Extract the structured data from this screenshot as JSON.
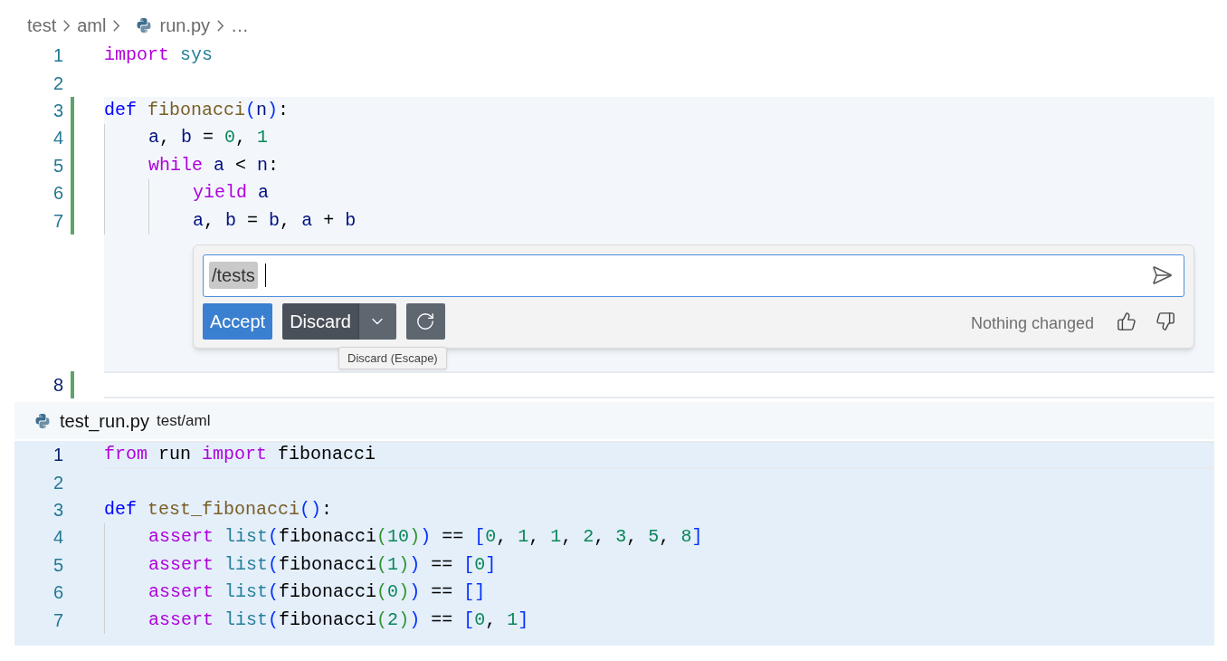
{
  "breadcrumb": [
    {
      "label": "test",
      "kind": "folder"
    },
    {
      "label": "aml",
      "kind": "folder"
    },
    {
      "label": "run.py",
      "kind": "python-file"
    },
    {
      "label": "…",
      "kind": "more"
    }
  ],
  "editor": {
    "lines": [
      {
        "number": "1",
        "changed": false,
        "current": false,
        "tokens": [
          {
            "kind": "keyword",
            "text": "import"
          },
          {
            "kind": "module",
            "text": " sys"
          }
        ]
      },
      {
        "number": "2",
        "changed": false,
        "current": false
      },
      {
        "number": "3",
        "changed": true,
        "current": false,
        "tokens": [
          {
            "kind": "storage",
            "text": "def"
          },
          {
            "kind": "function",
            "text": " fibonacci"
          },
          {
            "kind": "bracket",
            "text": "("
          },
          {
            "kind": "variable",
            "text": "n"
          },
          {
            "kind": "bracket",
            "text": ")"
          },
          {
            "kind": "plain",
            "text": ":"
          }
        ]
      },
      {
        "number": "4",
        "changed": true,
        "current": false,
        "tokens": [
          {
            "kind": "variable",
            "text": "    a"
          },
          {
            "kind": "plain",
            "text": ", "
          },
          {
            "kind": "variable",
            "text": "b"
          },
          {
            "kind": "plain",
            "text": " = "
          },
          {
            "kind": "number",
            "text": "0"
          },
          {
            "kind": "plain",
            "text": ", "
          },
          {
            "kind": "number",
            "text": "1"
          }
        ]
      },
      {
        "number": "5",
        "changed": true,
        "current": false,
        "tokens": [
          {
            "kind": "keyword",
            "text": "    while"
          },
          {
            "kind": "variable",
            "text": " a"
          },
          {
            "kind": "plain",
            "text": " < "
          },
          {
            "kind": "variable",
            "text": "n"
          },
          {
            "kind": "plain",
            "text": ":"
          }
        ]
      },
      {
        "number": "6",
        "changed": true,
        "current": false,
        "tokens": [
          {
            "kind": "keyword",
            "text": "        yield"
          },
          {
            "kind": "variable",
            "text": " a"
          }
        ]
      },
      {
        "number": "7",
        "changed": true,
        "current": false,
        "tokens": [
          {
            "kind": "variable",
            "text": "        a"
          },
          {
            "kind": "plain",
            "text": ", "
          },
          {
            "kind": "variable",
            "text": "b"
          },
          {
            "kind": "plain",
            "text": " = "
          },
          {
            "kind": "variable",
            "text": "b"
          },
          {
            "kind": "plain",
            "text": ", "
          },
          {
            "kind": "variable",
            "text": "a"
          },
          {
            "kind": "plain",
            "text": " + "
          },
          {
            "kind": "variable",
            "text": "b"
          }
        ]
      }
    ],
    "inline_chat": {
      "command": "/tests",
      "accept": "Accept",
      "discard": "Discard",
      "status": "Nothing changed",
      "tooltip": "Discard (Escape)"
    },
    "after_lines": [
      {
        "number": "8",
        "changed": true,
        "current": true
      }
    ]
  },
  "peek": {
    "file": "test_run.py",
    "path": "test/aml",
    "lines": [
      {
        "number": "1",
        "current": true,
        "tokens": [
          {
            "kind": "keyword",
            "text": "from"
          },
          {
            "kind": "plain",
            "text": " run "
          },
          {
            "kind": "keyword",
            "text": "import"
          },
          {
            "kind": "plain",
            "text": " fibonacci"
          }
        ]
      },
      {
        "number": "2",
        "current": false
      },
      {
        "number": "3",
        "current": false,
        "tokens": [
          {
            "kind": "storage",
            "text": "def"
          },
          {
            "kind": "function",
            "text": " test_fibonacci"
          },
          {
            "kind": "bracket",
            "text": "()"
          },
          {
            "kind": "plain",
            "text": ":"
          }
        ]
      },
      {
        "number": "4",
        "current": false,
        "tokens": [
          {
            "kind": "keyword",
            "text": "    assert"
          },
          {
            "kind": "builtin",
            "text": " list"
          },
          {
            "kind": "bracket",
            "text": "("
          },
          {
            "kind": "plain",
            "text": "fibonacci"
          },
          {
            "kind": "bracket2",
            "text": "("
          },
          {
            "kind": "number",
            "text": "10"
          },
          {
            "kind": "bracket2",
            "text": ")"
          },
          {
            "kind": "bracket",
            "text": ")"
          },
          {
            "kind": "plain",
            "text": " == "
          },
          {
            "kind": "bracket",
            "text": "["
          },
          {
            "kind": "number",
            "text": "0"
          },
          {
            "kind": "plain",
            "text": ", "
          },
          {
            "kind": "number",
            "text": "1"
          },
          {
            "kind": "plain",
            "text": ", "
          },
          {
            "kind": "number",
            "text": "1"
          },
          {
            "kind": "plain",
            "text": ", "
          },
          {
            "kind": "number",
            "text": "2"
          },
          {
            "kind": "plain",
            "text": ", "
          },
          {
            "kind": "number",
            "text": "3"
          },
          {
            "kind": "plain",
            "text": ", "
          },
          {
            "kind": "number",
            "text": "5"
          },
          {
            "kind": "plain",
            "text": ", "
          },
          {
            "kind": "number",
            "text": "8"
          },
          {
            "kind": "bracket",
            "text": "]"
          }
        ]
      },
      {
        "number": "5",
        "current": false,
        "tokens": [
          {
            "kind": "keyword",
            "text": "    assert"
          },
          {
            "kind": "builtin",
            "text": " list"
          },
          {
            "kind": "bracket",
            "text": "("
          },
          {
            "kind": "plain",
            "text": "fibonacci"
          },
          {
            "kind": "bracket2",
            "text": "("
          },
          {
            "kind": "number",
            "text": "1"
          },
          {
            "kind": "bracket2",
            "text": ")"
          },
          {
            "kind": "bracket",
            "text": ")"
          },
          {
            "kind": "plain",
            "text": " == "
          },
          {
            "kind": "bracket",
            "text": "["
          },
          {
            "kind": "number",
            "text": "0"
          },
          {
            "kind": "bracket",
            "text": "]"
          }
        ]
      },
      {
        "number": "6",
        "current": false,
        "tokens": [
          {
            "kind": "keyword",
            "text": "    assert"
          },
          {
            "kind": "builtin",
            "text": " list"
          },
          {
            "kind": "bracket",
            "text": "("
          },
          {
            "kind": "plain",
            "text": "fibonacci"
          },
          {
            "kind": "bracket2",
            "text": "("
          },
          {
            "kind": "number",
            "text": "0"
          },
          {
            "kind": "bracket2",
            "text": ")"
          },
          {
            "kind": "bracket",
            "text": ")"
          },
          {
            "kind": "plain",
            "text": " == "
          },
          {
            "kind": "bracket",
            "text": "[]"
          }
        ]
      },
      {
        "number": "7",
        "current": false,
        "tokens": [
          {
            "kind": "keyword",
            "text": "    assert"
          },
          {
            "kind": "builtin",
            "text": " list"
          },
          {
            "kind": "bracket",
            "text": "("
          },
          {
            "kind": "plain",
            "text": "fibonacci"
          },
          {
            "kind": "bracket2",
            "text": "("
          },
          {
            "kind": "number",
            "text": "2"
          },
          {
            "kind": "bracket2",
            "text": ")"
          },
          {
            "kind": "bracket",
            "text": ")"
          },
          {
            "kind": "plain",
            "text": " == "
          },
          {
            "kind": "bracket",
            "text": "["
          },
          {
            "kind": "number",
            "text": "0"
          },
          {
            "kind": "plain",
            "text": ", "
          },
          {
            "kind": "number",
            "text": "1"
          },
          {
            "kind": "bracket",
            "text": "]"
          }
        ]
      }
    ]
  }
}
